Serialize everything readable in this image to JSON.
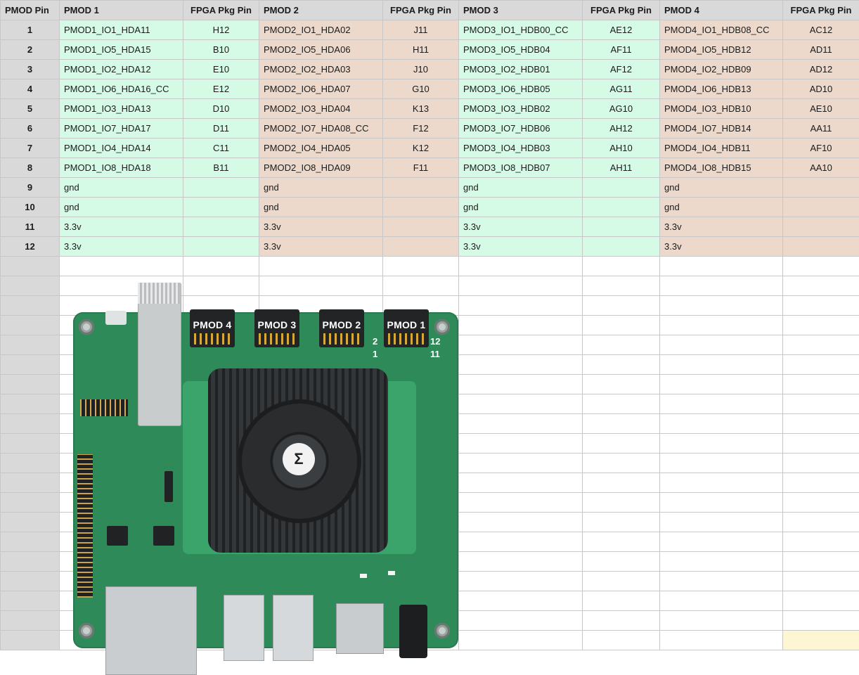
{
  "headers": [
    "PMOD Pin",
    "PMOD 1",
    "FPGA Pkg Pin",
    "PMOD 2",
    "FPGA Pkg Pin",
    "PMOD 3",
    "FPGA Pkg Pin",
    "PMOD 4",
    "FPGA Pkg Pin"
  ],
  "rows": [
    {
      "pin": "1",
      "p1": "PMOD1_IO1_HDA11",
      "f1": "H12",
      "p2": "PMOD2_IO1_HDA02",
      "f2": "J11",
      "p3": "PMOD3_IO1_HDB00_CC",
      "f3": "AE12",
      "p4": "PMOD4_IO1_HDB08_CC",
      "f4": "AC12"
    },
    {
      "pin": "2",
      "p1": "PMOD1_IO5_HDA15",
      "f1": "B10",
      "p2": "PMOD2_IO5_HDA06",
      "f2": "H11",
      "p3": "PMOD3_IO5_HDB04",
      "f3": "AF11",
      "p4": "PMOD4_IO5_HDB12",
      "f4": "AD11"
    },
    {
      "pin": "3",
      "p1": "PMOD1_IO2_HDA12",
      "f1": "E10",
      "p2": "PMOD2_IO2_HDA03",
      "f2": "J10",
      "p3": "PMOD3_IO2_HDB01",
      "f3": "AF12",
      "p4": "PMOD4_IO2_HDB09",
      "f4": "AD12"
    },
    {
      "pin": "4",
      "p1": "PMOD1_IO6_HDA16_CC",
      "f1": "E12",
      "p2": "PMOD2_IO6_HDA07",
      "f2": "G10",
      "p3": "PMOD3_IO6_HDB05",
      "f3": "AG11",
      "p4": "PMOD4_IO6_HDB13",
      "f4": "AD10"
    },
    {
      "pin": "5",
      "p1": "PMOD1_IO3_HDA13",
      "f1": "D10",
      "p2": "PMOD2_IO3_HDA04",
      "f2": "K13",
      "p3": "PMOD3_IO3_HDB02",
      "f3": "AG10",
      "p4": "PMOD4_IO3_HDB10",
      "f4": "AE10"
    },
    {
      "pin": "6",
      "p1": "PMOD1_IO7_HDA17",
      "f1": "D11",
      "p2": "PMOD2_IO7_HDA08_CC",
      "f2": "F12",
      "p3": "PMOD3_IO7_HDB06",
      "f3": "AH12",
      "p4": "PMOD4_IO7_HDB14",
      "f4": "AA11"
    },
    {
      "pin": "7",
      "p1": "PMOD1_IO4_HDA14",
      "f1": "C11",
      "p2": "PMOD2_IO4_HDA05",
      "f2": "K12",
      "p3": "PMOD3_IO4_HDB03",
      "f3": "AH10",
      "p4": "PMOD4_IO4_HDB11",
      "f4": "AF10"
    },
    {
      "pin": "8",
      "p1": "PMOD1_IO8_HDA18",
      "f1": "B11",
      "p2": "PMOD2_IO8_HDA09",
      "f2": "F11",
      "p3": "PMOD3_IO8_HDB07",
      "f3": "AH11",
      "p4": "PMOD4_IO8_HDB15",
      "f4": "AA10"
    },
    {
      "pin": "9",
      "p1": "gnd",
      "f1": "",
      "p2": "gnd",
      "f2": "",
      "p3": "gnd",
      "f3": "",
      "p4": "gnd",
      "f4": ""
    },
    {
      "pin": "10",
      "p1": "gnd",
      "f1": "",
      "p2": "gnd",
      "f2": "",
      "p3": "gnd",
      "f3": "",
      "p4": "gnd",
      "f4": ""
    },
    {
      "pin": "11",
      "p1": "3.3v",
      "f1": "",
      "p2": "3.3v",
      "f2": "",
      "p3": "3.3v",
      "f3": "",
      "p4": "3.3v",
      "f4": ""
    },
    {
      "pin": "12",
      "p1": "3.3v",
      "f1": "",
      "p2": "3.3v",
      "f2": "",
      "p3": "3.3v",
      "f3": "",
      "p4": "3.3v",
      "f4": ""
    }
  ],
  "board": {
    "labels": [
      "PMOD 4",
      "PMOD 3",
      "PMOD 2",
      "PMOD 1"
    ],
    "pin_marks": {
      "top_left": "2",
      "bottom_left": "1",
      "top_right": "12",
      "bottom_right": "11"
    },
    "logo": "Σ"
  },
  "colors": {
    "header_gray": "#d9d9d9",
    "green": "#d5fbe6",
    "tan": "#ecd9cb",
    "pcb": "#2f8a5a"
  }
}
